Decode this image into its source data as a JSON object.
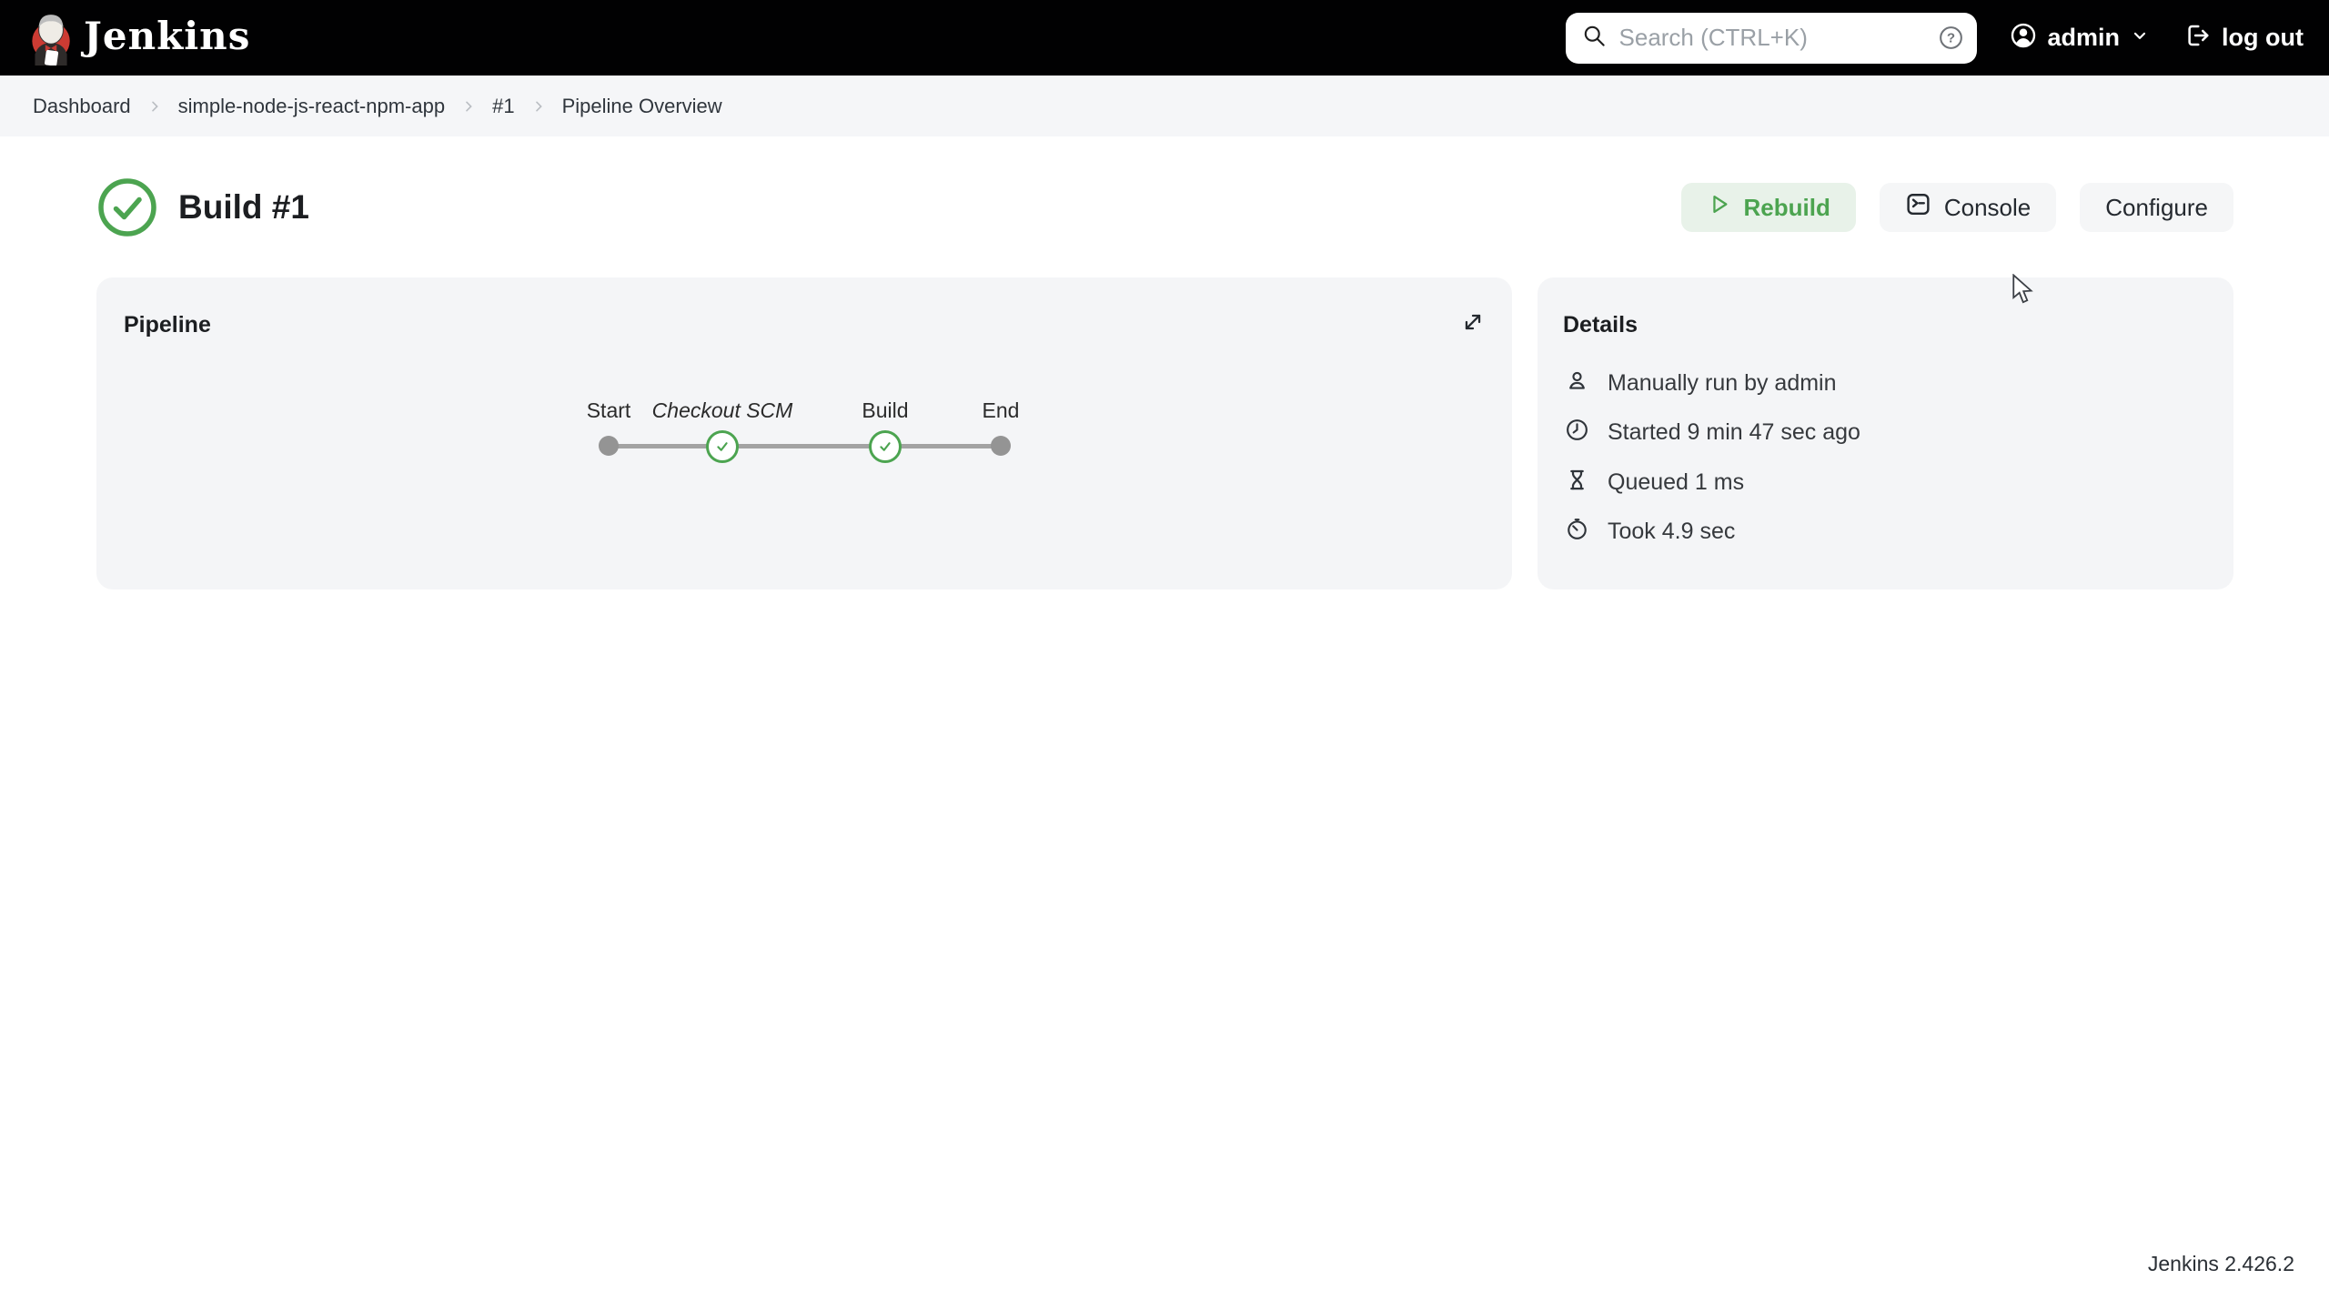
{
  "topbar": {
    "brand": "Jenkins",
    "search": {
      "placeholder": "Search (CTRL+K)"
    },
    "user": {
      "name": "admin"
    },
    "logout_label": "log out"
  },
  "breadcrumb": {
    "items": [
      "Dashboard",
      "simple-node-js-react-npm-app",
      "#1",
      "Pipeline Overview"
    ]
  },
  "page": {
    "title": "Build #1",
    "status": "success",
    "actions": {
      "rebuild": "Rebuild",
      "console": "Console",
      "configure": "Configure"
    }
  },
  "pipeline": {
    "heading": "Pipeline",
    "stages": [
      {
        "label": "Start",
        "type": "terminal"
      },
      {
        "label": "Checkout SCM",
        "type": "stage",
        "status": "success"
      },
      {
        "label": "Build",
        "type": "stage",
        "status": "success"
      },
      {
        "label": "End",
        "type": "terminal"
      }
    ]
  },
  "details": {
    "heading": "Details",
    "items": [
      {
        "icon": "person-icon",
        "text": "Manually run by admin"
      },
      {
        "icon": "clock-icon",
        "text": "Started 9 min 47 sec ago"
      },
      {
        "icon": "hourglass-icon",
        "text": "Queued 1 ms"
      },
      {
        "icon": "stopwatch-icon",
        "text": "Took 4.9 sec"
      }
    ]
  },
  "footer": {
    "version": "Jenkins 2.426.2"
  },
  "icons": {
    "search": "magnifier",
    "help": "question-circle",
    "user": "person-circle",
    "chevron_down": "chevron",
    "logout": "door-with-arrow",
    "success": "check-circle",
    "play": "triangle-outline",
    "console": "terminal-window",
    "expand": "diagonal-double-arrow",
    "cursor": "arrow-pointer"
  },
  "colors": {
    "success_green": "#4ca450",
    "rebuild_bg": "#e8f2e9",
    "topbar_bg": "#010102",
    "card_bg": "#f4f5f7",
    "breadcrumb_bg": "#f5f6f8",
    "jenkins_red": "#cc3b33"
  }
}
